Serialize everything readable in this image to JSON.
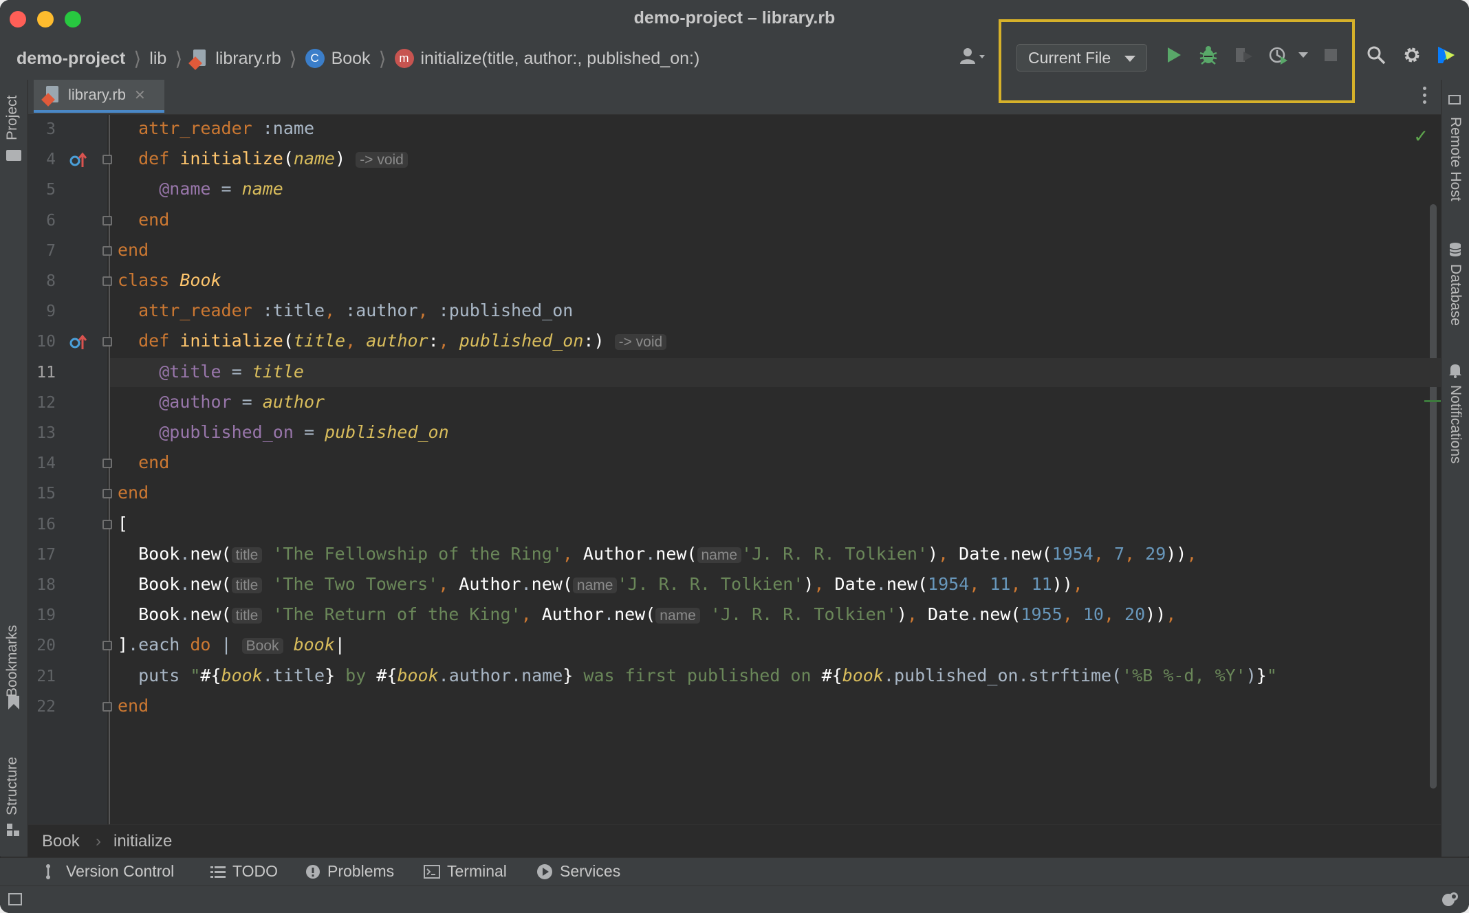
{
  "window": {
    "title": "demo-project – library.rb"
  },
  "breadcrumbs": {
    "project": "demo-project",
    "folder": "lib",
    "file": "library.rb",
    "class_badge": "C",
    "class": "Book",
    "method_badge": "m",
    "method": "initialize(title, author:, published_on:)"
  },
  "toolbar": {
    "run_config": "Current File",
    "icons": [
      "user-icon",
      "run-icon",
      "debug-icon",
      "coverage-icon",
      "profile-icon",
      "stop-icon",
      "search-icon",
      "gear-icon",
      "logo-icon"
    ]
  },
  "tabs": [
    {
      "label": "library.rb"
    }
  ],
  "left_panel": {
    "project": "Project",
    "bookmarks": "Bookmarks",
    "structure": "Structure"
  },
  "right_panel": {
    "remote_host": "Remote Host",
    "database": "Database",
    "notifications": "Notifications"
  },
  "editor": {
    "current_line": 11,
    "line_numbers": [
      "3",
      "4",
      "5",
      "6",
      "7",
      "8",
      "9",
      "10",
      "11",
      "12",
      "13",
      "14",
      "15",
      "16",
      "17",
      "18",
      "19",
      "20",
      "21",
      "22"
    ],
    "lines": [
      {
        "n": "3",
        "tokens": [
          [
            "sym",
            "  "
          ],
          [
            "kw",
            "attr_reader"
          ],
          [
            "sym",
            " :name"
          ]
        ]
      },
      {
        "n": "4",
        "tokens": [
          [
            "sym",
            "  "
          ],
          [
            "kw",
            "def "
          ],
          [
            "fn",
            "initialize"
          ],
          [
            "wh",
            "("
          ],
          [
            "it",
            "name"
          ],
          [
            "wh",
            ")"
          ],
          [
            "sym",
            " "
          ],
          [
            "hint",
            "-> void"
          ]
        ]
      },
      {
        "n": "5",
        "tokens": [
          [
            "sym",
            "    "
          ],
          [
            "ivar",
            "@name"
          ],
          [
            "sym",
            " = "
          ],
          [
            "it",
            "name"
          ]
        ]
      },
      {
        "n": "6",
        "tokens": [
          [
            "sym",
            "  "
          ],
          [
            "kw",
            "end"
          ]
        ]
      },
      {
        "n": "7",
        "tokens": [
          [
            "kw",
            "end"
          ]
        ]
      },
      {
        "n": "8",
        "tokens": [
          [
            "kw",
            "class "
          ],
          [
            "cls",
            "Book"
          ]
        ]
      },
      {
        "n": "9",
        "tokens": [
          [
            "sym",
            "  "
          ],
          [
            "kw",
            "attr_reader"
          ],
          [
            "sym",
            " :title"
          ],
          [
            "kw",
            ","
          ],
          [
            "sym",
            " :author"
          ],
          [
            "kw",
            ","
          ],
          [
            "sym",
            " :published_on"
          ]
        ]
      },
      {
        "n": "10",
        "tokens": [
          [
            "sym",
            "  "
          ],
          [
            "kw",
            "def "
          ],
          [
            "fn",
            "initialize"
          ],
          [
            "wh",
            "("
          ],
          [
            "it",
            "title"
          ],
          [
            "kw",
            ","
          ],
          [
            "sym",
            " "
          ],
          [
            "it",
            "author"
          ],
          [
            "wh",
            ":"
          ],
          [
            "kw",
            ","
          ],
          [
            "sym",
            " "
          ],
          [
            "it",
            "published_on"
          ],
          [
            "wh",
            ":)"
          ],
          [
            "sym",
            " "
          ],
          [
            "hint",
            "-> void"
          ]
        ]
      },
      {
        "n": "11",
        "tokens": [
          [
            "sym",
            "    "
          ],
          [
            "ivar",
            "@title"
          ],
          [
            "sym",
            " = "
          ],
          [
            "it",
            "title"
          ]
        ]
      },
      {
        "n": "12",
        "tokens": [
          [
            "sym",
            "    "
          ],
          [
            "ivar",
            "@author"
          ],
          [
            "sym",
            " = "
          ],
          [
            "it",
            "author"
          ]
        ]
      },
      {
        "n": "13",
        "tokens": [
          [
            "sym",
            "    "
          ],
          [
            "ivar",
            "@published_on"
          ],
          [
            "sym",
            " = "
          ],
          [
            "it",
            "published_on"
          ]
        ]
      },
      {
        "n": "14",
        "tokens": [
          [
            "sym",
            "  "
          ],
          [
            "kw",
            "end"
          ]
        ]
      },
      {
        "n": "15",
        "tokens": [
          [
            "kw",
            "end"
          ]
        ]
      },
      {
        "n": "16",
        "tokens": [
          [
            "wh",
            "["
          ]
        ]
      },
      {
        "n": "17",
        "tokens": [
          [
            "sym",
            "  "
          ],
          [
            "wh",
            "Book"
          ],
          [
            "sym",
            "."
          ],
          [
            "wh",
            "new("
          ],
          [
            "hint",
            "title"
          ],
          [
            "sym",
            " "
          ],
          [
            "str",
            "'The Fellowship of the Ring'"
          ],
          [
            "kw",
            ", "
          ],
          [
            "wh",
            "Author"
          ],
          [
            "sym",
            "."
          ],
          [
            "wh",
            "new("
          ],
          [
            "hint",
            "name"
          ],
          [
            "str",
            "'J. R. R. Tolkien'"
          ],
          [
            "wh",
            ")"
          ],
          [
            "kw",
            ", "
          ],
          [
            "wh",
            "Date"
          ],
          [
            "sym",
            "."
          ],
          [
            "wh",
            "new("
          ],
          [
            "num",
            "1954"
          ],
          [
            "kw",
            ", "
          ],
          [
            "num",
            "7"
          ],
          [
            "kw",
            ", "
          ],
          [
            "num",
            "29"
          ],
          [
            "wh",
            "))"
          ],
          [
            "kw",
            ","
          ]
        ]
      },
      {
        "n": "18",
        "tokens": [
          [
            "sym",
            "  "
          ],
          [
            "wh",
            "Book"
          ],
          [
            "sym",
            "."
          ],
          [
            "wh",
            "new("
          ],
          [
            "hint",
            "title"
          ],
          [
            "sym",
            " "
          ],
          [
            "str",
            "'The Two Towers'"
          ],
          [
            "kw",
            ", "
          ],
          [
            "wh",
            "Author"
          ],
          [
            "sym",
            "."
          ],
          [
            "wh",
            "new("
          ],
          [
            "hint",
            "name"
          ],
          [
            "str",
            "'J. R. R. Tolkien'"
          ],
          [
            "wh",
            ")"
          ],
          [
            "kw",
            ", "
          ],
          [
            "wh",
            "Date"
          ],
          [
            "sym",
            "."
          ],
          [
            "wh",
            "new("
          ],
          [
            "num",
            "1954"
          ],
          [
            "kw",
            ", "
          ],
          [
            "num",
            "11"
          ],
          [
            "kw",
            ", "
          ],
          [
            "num",
            "11"
          ],
          [
            "wh",
            "))"
          ],
          [
            "kw",
            ","
          ]
        ]
      },
      {
        "n": "19",
        "tokens": [
          [
            "sym",
            "  "
          ],
          [
            "wh",
            "Book"
          ],
          [
            "sym",
            "."
          ],
          [
            "wh",
            "new("
          ],
          [
            "hint",
            "title"
          ],
          [
            "sym",
            " "
          ],
          [
            "str",
            "'The Return of the King'"
          ],
          [
            "kw",
            ", "
          ],
          [
            "wh",
            "Author"
          ],
          [
            "sym",
            "."
          ],
          [
            "wh",
            "new("
          ],
          [
            "hint",
            "name"
          ],
          [
            "sym",
            " "
          ],
          [
            "str",
            "'J. R. R. Tolkien'"
          ],
          [
            "wh",
            ")"
          ],
          [
            "kw",
            ", "
          ],
          [
            "wh",
            "Date"
          ],
          [
            "sym",
            "."
          ],
          [
            "wh",
            "new("
          ],
          [
            "num",
            "1955"
          ],
          [
            "kw",
            ", "
          ],
          [
            "num",
            "10"
          ],
          [
            "kw",
            ", "
          ],
          [
            "num",
            "20"
          ],
          [
            "wh",
            "))"
          ],
          [
            "kw",
            ","
          ]
        ]
      },
      {
        "n": "20",
        "tokens": [
          [
            "wh",
            "]"
          ],
          [
            "sym",
            ".each "
          ],
          [
            "kw",
            "do"
          ],
          [
            "sym",
            " | "
          ],
          [
            "hint",
            "Book"
          ],
          [
            "sym",
            " "
          ],
          [
            "it",
            "book"
          ],
          [
            "wh",
            "|"
          ]
        ]
      },
      {
        "n": "21",
        "tokens": [
          [
            "sym",
            "  puts "
          ],
          [
            "str",
            "\""
          ],
          [
            "wh",
            "#{"
          ],
          [
            "it",
            "book"
          ],
          [
            "sym",
            ".title"
          ],
          [
            "wh",
            "}"
          ],
          [
            "str",
            " by "
          ],
          [
            "wh",
            "#{"
          ],
          [
            "it",
            "book"
          ],
          [
            "sym",
            ".author.name"
          ],
          [
            "wh",
            "}"
          ],
          [
            "str",
            " was first published on "
          ],
          [
            "wh",
            "#{"
          ],
          [
            "it",
            "book"
          ],
          [
            "sym",
            ".published_on.strftime("
          ],
          [
            "str",
            "'%B %-d, %Y'"
          ],
          [
            "sym",
            ")"
          ],
          [
            "wh",
            "}"
          ],
          [
            "str",
            "\""
          ]
        ]
      },
      {
        "n": "22",
        "tokens": [
          [
            "kw",
            "end"
          ]
        ]
      }
    ]
  },
  "editor_breadcrumb": {
    "class": "Book",
    "method": "initialize"
  },
  "bottom_tools": [
    {
      "label": "Version Control",
      "icon": "branch-icon"
    },
    {
      "label": "TODO",
      "icon": "list-icon"
    },
    {
      "label": "Problems",
      "icon": "problems-icon"
    },
    {
      "label": "Terminal",
      "icon": "terminal-icon"
    },
    {
      "label": "Services",
      "icon": "services-icon"
    }
  ],
  "colors": {
    "highlight_box": "#d6b12a",
    "run": "#59a869",
    "keyword": "#cc7832",
    "string": "#6a8759",
    "number": "#6897bb"
  }
}
